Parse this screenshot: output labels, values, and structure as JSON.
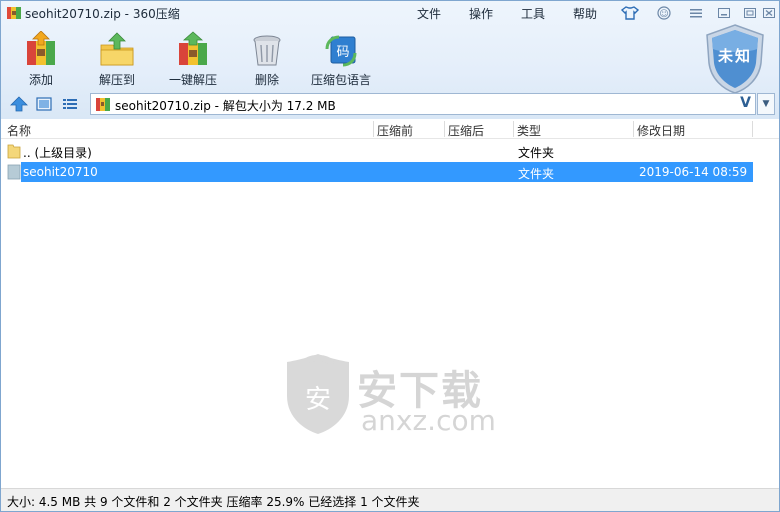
{
  "window": {
    "title": "seohit20710.zip - 360压缩"
  },
  "menu": [
    "文件",
    "操作",
    "工具",
    "帮助"
  ],
  "toolbar": [
    {
      "label": "添加",
      "icon": "add-archive-icon"
    },
    {
      "label": "解压到",
      "icon": "extract-to-icon"
    },
    {
      "label": "一键解压",
      "icon": "one-click-extract-icon"
    },
    {
      "label": "删除",
      "icon": "delete-bin-icon"
    },
    {
      "label": "压缩包语言",
      "icon": "archive-language-icon",
      "badge": "码"
    }
  ],
  "shield": {
    "label": "未知"
  },
  "address": {
    "text": "seohit20710.zip - 解包大小为 17.2 MB",
    "v": "V",
    "dropdown": "▼"
  },
  "columns": [
    "名称",
    "压缩前",
    "压缩后",
    "类型",
    "修改日期"
  ],
  "rows": [
    {
      "name": ".. (上级目录)",
      "before": "",
      "after": "",
      "type": "文件夹",
      "date": "",
      "selected": false
    },
    {
      "name": "seohit20710",
      "before": "",
      "after": "",
      "type": "文件夹",
      "date": "2019-06-14 08:59",
      "selected": true
    }
  ],
  "watermark": {
    "cn": "安下载",
    "en": "anxz.com",
    "badge": "安"
  },
  "status": {
    "text": "大小: 4.5 MB 共 9 个文件和 2 个文件夹 压缩率 25.9% 已经选择 1 个文件夹"
  },
  "colors": {
    "selection": "#3399ff",
    "accent": "#2d6db5"
  }
}
